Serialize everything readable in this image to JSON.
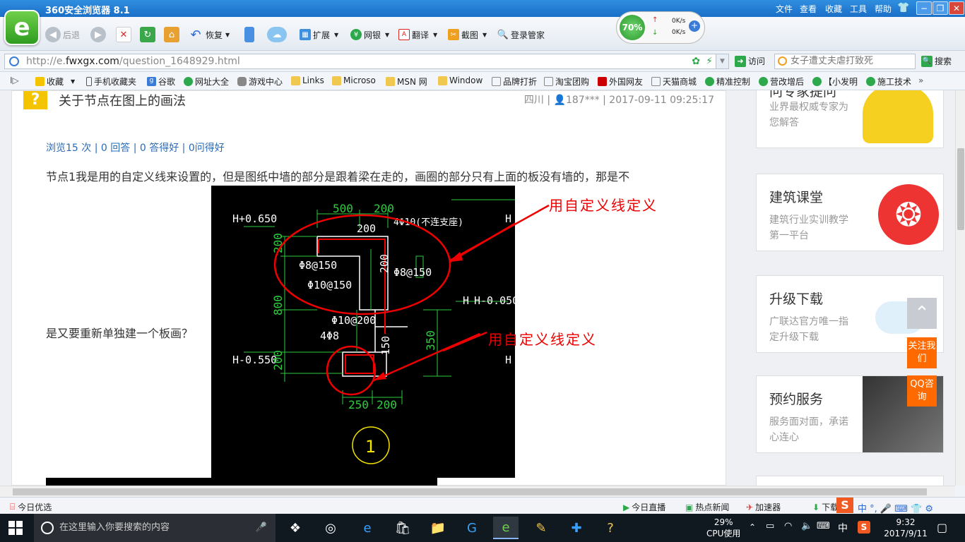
{
  "window": {
    "title": "360安全浏览器 8.1",
    "menus": [
      "文件",
      "查看",
      "收藏",
      "工具",
      "帮助"
    ],
    "controls": [
      "−",
      "❐",
      "✕"
    ]
  },
  "toolbar": {
    "back": "后退",
    "restore": "恢复",
    "extend": "扩展",
    "bank": "网银",
    "translate": "翻译",
    "screenshot": "截图",
    "login": "登录管家"
  },
  "speed": {
    "percent": "70%",
    "up": "0K/s",
    "down": "0K/s"
  },
  "address": {
    "url_prefix": "http://e.",
    "url_domain": "fwxgx.com",
    "url_path": "/question_1648929.html",
    "visit": "访问",
    "search_placeholder": "女子遭丈夫虐打致死",
    "search_button": "搜索"
  },
  "bookmarks": [
    "收藏",
    "手机收藏夹",
    "谷歌",
    "网址大全",
    "游戏中心",
    "Links",
    "Microso",
    "MSN 网",
    "Window",
    "品牌打折",
    "淘宝团购",
    "外国网友",
    "天猫商城",
    "精准控制",
    "营改增后",
    "【小发明",
    "施工技术"
  ],
  "question": {
    "title": "关于节点在图上的画法",
    "meta": "四川 | 👤187*** | 2017-09-11 09:25:17",
    "stats": "浏览15 次 | 0 回答 | 0 答得好 | 0问得好",
    "body_line1": "节点1我是用的自定义线来设置的，但是图纸中墙的部分是跟着梁在走的，画圈的部分只有上面的板没有墙的，那是不",
    "body_line2": "是又要重新单独建一个板画？"
  },
  "cad": {
    "annotation1": "用自定义线定义",
    "annotation2": "用自定义线定义",
    "elev1": "H+0.650",
    "elev2": "H-0.050",
    "elev3": "H-0.550",
    "dim500": "500",
    "dim200a": "200",
    "dim200b": "200",
    "dim200c": "200",
    "dim200d": "200",
    "dim200e": "200",
    "dim800": "800",
    "dim350": "350",
    "dim250": "250",
    "dim200f": "200",
    "dim150": "150",
    "rebar1": "4Φ10(不连支座)",
    "rebar2": "Φ8@150",
    "rebar3": "Φ8@150",
    "rebar4": "Φ10@150",
    "rebar5": "Φ10@200",
    "rebar6": "4Φ8",
    "node": "1",
    "hmark": "H"
  },
  "sidebar": [
    {
      "title": "问专家提问",
      "desc": "业界最权威专家为您解答"
    },
    {
      "title": "建筑课堂",
      "desc": "建筑行业实训教学第一平台"
    },
    {
      "title": "升级下载",
      "desc": "广联达官方唯一指定升级下载"
    },
    {
      "title": "预约服务",
      "desc": "服务面对面，承诺心连心"
    }
  ],
  "float": {
    "follow": "关注我们",
    "qq": "QQ咨询"
  },
  "status": {
    "left": "今日优选",
    "live": "今日直播",
    "news": "热点新闻",
    "accel": "加速器",
    "download": "下载"
  },
  "taskbar": {
    "search_placeholder": "在这里输入你要搜索的内容",
    "cpu_percent": "29%",
    "cpu_label": "CPU使用",
    "ime": "中",
    "time": "9:32",
    "date": "2017/9/11"
  },
  "colors": {
    "title_blue": "#1b6fc7",
    "cad_green": "#2ecc40",
    "annot_red": "#e00000",
    "accent_orange": "#ff6a00"
  }
}
